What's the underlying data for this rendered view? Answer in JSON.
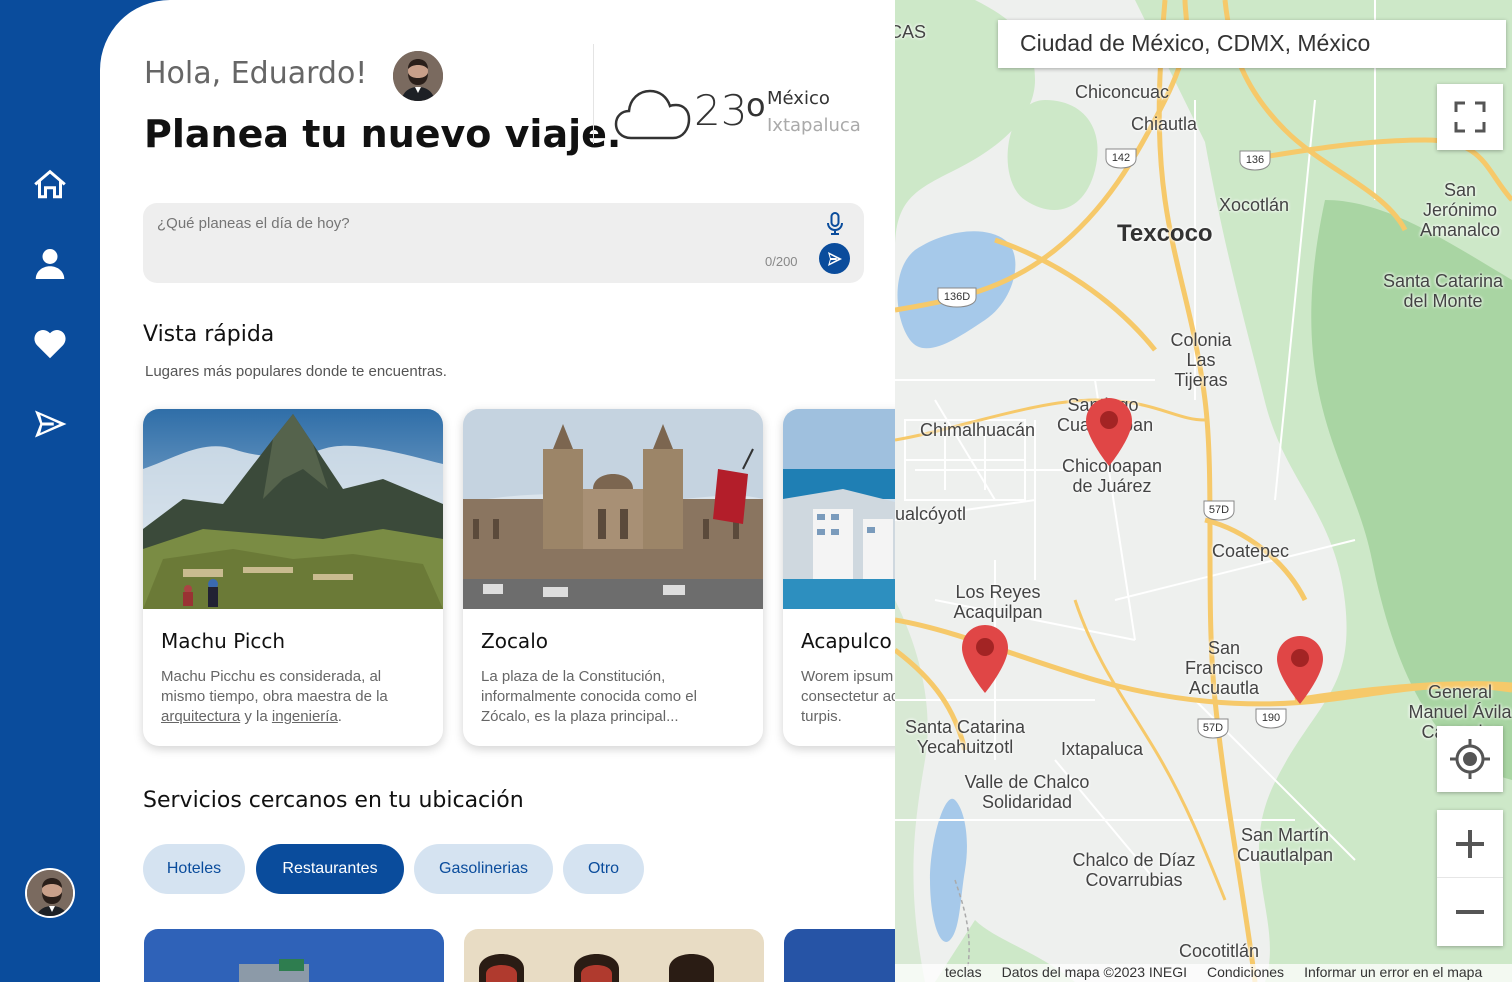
{
  "user": {
    "greeting": "Hola, Eduardo!",
    "headline": "Planea tu nuevo viaje."
  },
  "weather": {
    "temp": "23",
    "deg": "o",
    "city": "México",
    "town": "Ixtapaluca",
    "icon": "cloud-icon"
  },
  "search": {
    "placeholder": "¿Qué planeas el día de hoy?",
    "counter": "0/200"
  },
  "quick_view": {
    "title": "Vista rápida",
    "subtitle": "Lugares más populares donde te encuentras.",
    "cards": [
      {
        "title": "Machu Picch",
        "desc_pre": "Machu Picchu es considerada, al mismo tiempo, obra maestra de la ",
        "link1": "arquitectura",
        "mid": " y la ",
        "link2": "ingeniería",
        "end": "."
      },
      {
        "title": "Zocalo",
        "desc": "La plaza de la Constitución, informalmente conocida como el Zócalo, es la plaza principal..."
      },
      {
        "title": "Acapulco",
        "desc": "Worem ipsum dolor sit amet, consectetur adipiscing elit. Nunc eu turpis."
      }
    ]
  },
  "services": {
    "title": "Servicios cercanos en tu ubicación",
    "chips": [
      "Hoteles",
      "Restaurantes",
      "Gasolinerias",
      "Otro"
    ],
    "active": "Restaurantes"
  },
  "map": {
    "search_value": "Ciudad de México, CDMX, México",
    "labels": {
      "cas": "CAS",
      "chiconcuac": "Chiconcuac",
      "chiautla": "Chiautla",
      "texcoco": "Texcoco",
      "xocotlan": "Xocotlán",
      "san_jeronimo": "San Jerónimo Amanalco",
      "santa_catarina_monte": "Santa Catarina del Monte",
      "colonia": "Colonia Las Tijeras",
      "chimalhuacan": "Chimalhuacán",
      "santiago": "Santiago Cuautlalpan",
      "chicoloapan": "Chicoloapan de Juárez",
      "coacalco": "ualcóyotl",
      "coatepec": "Coatepec",
      "los_reyes": "Los Reyes Acaquilpan",
      "san_francisco": "San Francisco Acuautla",
      "general": "General Manuel Ávila Camacho",
      "santa_catarina_yeca": "Santa Catarina Yecahuitzotl",
      "ixtapaluca": "Ixtapaluca",
      "valle": "Valle de Chalco Solidaridad",
      "san_martin": "San Martín Cuautlalpan",
      "chalco": "Chalco de Díaz Covarrubias",
      "cocotitlan": "Cocotitlán"
    },
    "shields": [
      "142",
      "136",
      "136D",
      "57D",
      "57D",
      "190"
    ],
    "footer": [
      "teclas",
      "Datos del mapa ©2023 INEGI",
      "Condiciones",
      "Informar un error en el mapa"
    ]
  }
}
